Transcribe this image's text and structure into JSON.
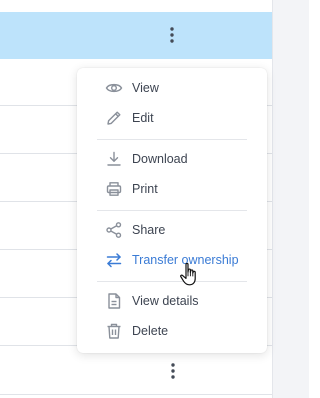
{
  "menu": {
    "items": [
      {
        "label": "View",
        "icon": "eye-icon"
      },
      {
        "label": "Edit",
        "icon": "pencil-icon"
      },
      {
        "label": "Download",
        "icon": "download-icon"
      },
      {
        "label": "Print",
        "icon": "printer-icon"
      },
      {
        "label": "Share",
        "icon": "share-icon"
      },
      {
        "label": "Transfer ownership",
        "icon": "transfer-arrows-icon"
      },
      {
        "label": "View details",
        "icon": "document-icon"
      },
      {
        "label": "Delete",
        "icon": "trash-icon"
      }
    ]
  },
  "colors": {
    "highlight_row": "#bde3fb",
    "active_item": "#3a7bd5",
    "text": "#3d4451",
    "icon": "#8a909a"
  }
}
